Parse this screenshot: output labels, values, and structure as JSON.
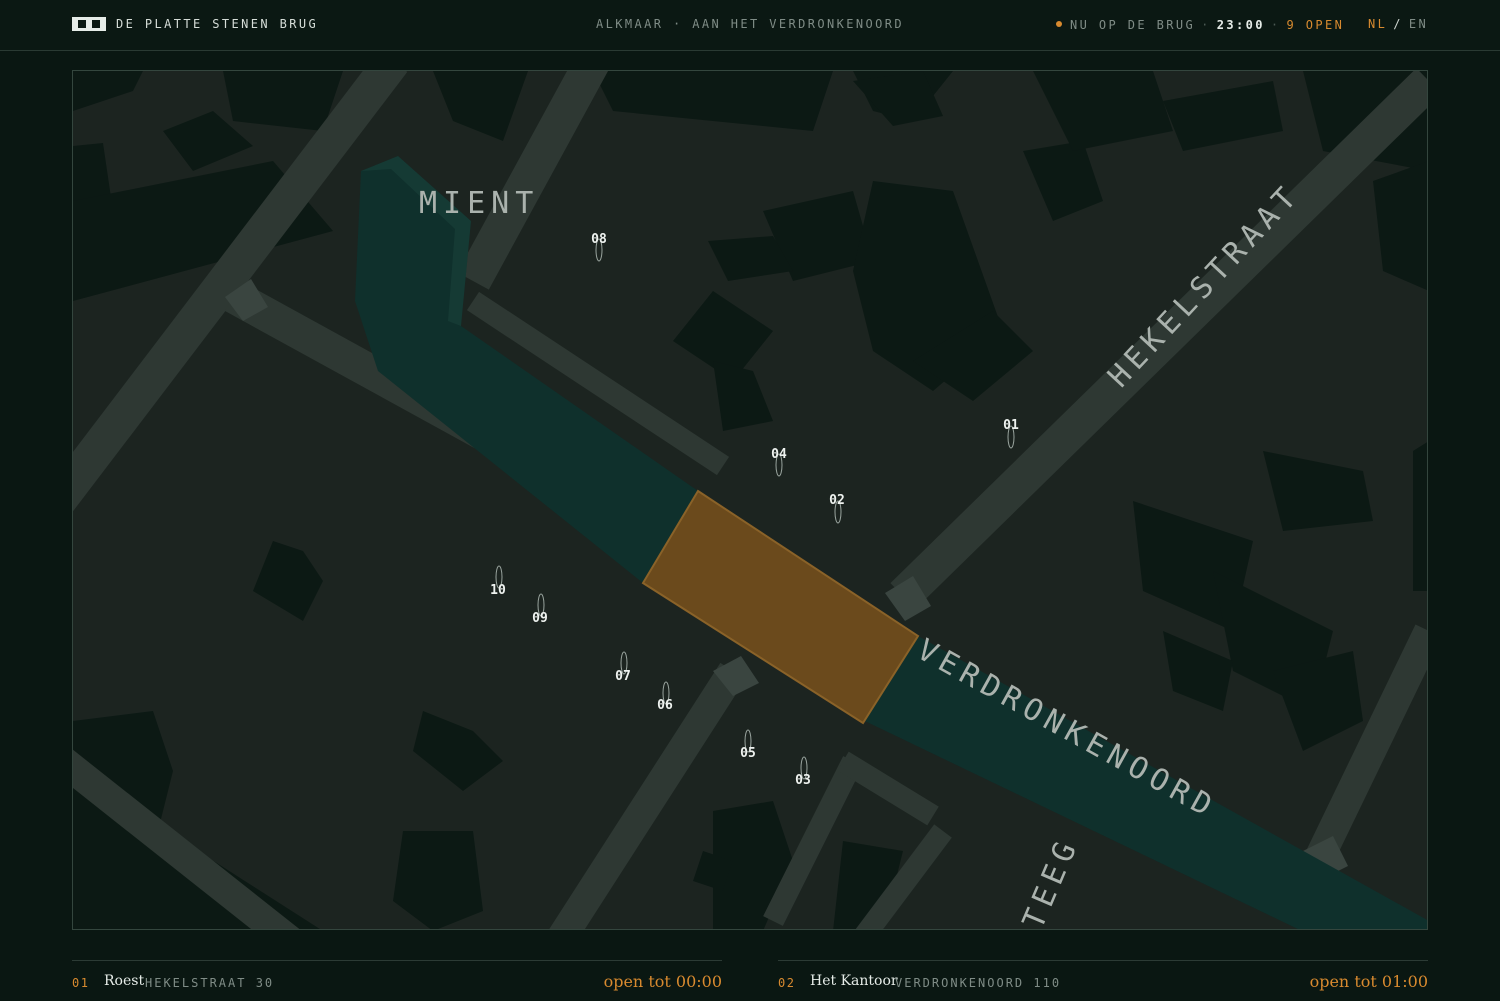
{
  "header": {
    "brand": "DE PLATTE STENEN BRUG",
    "location": "ALKMAAR · AAN HET VERDRONKENOORD",
    "status_label": "NU OP DE BRUG",
    "time": "23:00",
    "open_count": "9 OPEN",
    "lang_active": "NL",
    "lang_divider": "/",
    "lang_other": "EN"
  },
  "map": {
    "street_labels": {
      "mient": "MIENT",
      "hekelstraat": "HEKELSTRAAT",
      "verdronkenoord": "VERDRONKENOORD",
      "teeg": "TEEG"
    },
    "markers": [
      "01",
      "02",
      "03",
      "04",
      "05",
      "06",
      "07",
      "08",
      "09",
      "10"
    ]
  },
  "listing": [
    {
      "num": "01",
      "name": "Roest",
      "address": "HEKELSTRAAT 30",
      "hours": "open tot 00:00"
    },
    {
      "num": "02",
      "name": "Het Kantoor",
      "address": "VERDRONKENOORD 110",
      "hours": "open tot 01:00"
    }
  ],
  "colors": {
    "accent": "#d88a2f",
    "water": "#0f302c",
    "bridge": "#6b4a1c",
    "background": "#0a1712"
  }
}
